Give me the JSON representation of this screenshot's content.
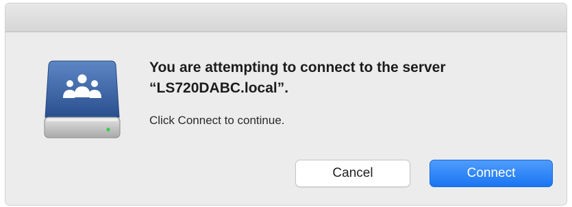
{
  "dialog": {
    "title": "You are attempting to connect to the server “LS720DABC.local”.",
    "message": "Click Connect to continue.",
    "icon": "network-server-drive-icon",
    "buttons": {
      "cancel_label": "Cancel",
      "connect_label": "Connect"
    }
  },
  "colors": {
    "accent": "#1a76f3",
    "background": "#ececec"
  }
}
